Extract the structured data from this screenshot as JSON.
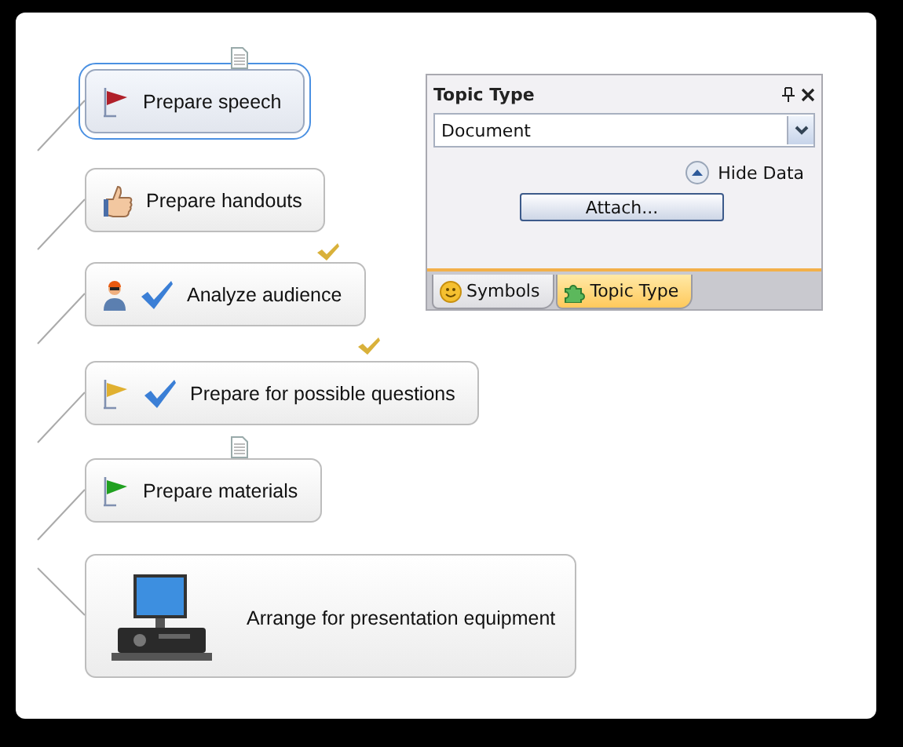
{
  "topics": [
    {
      "label": "Prepare speech",
      "selected": true,
      "note_attached": true,
      "completed": false,
      "symbols": [
        {
          "kind": "flag",
          "color": "#b0202a"
        }
      ]
    },
    {
      "label": "Prepare handouts",
      "selected": false,
      "note_attached": false,
      "completed": true,
      "symbols": [
        {
          "kind": "thumbs-up"
        }
      ]
    },
    {
      "label": "Analyze audience",
      "selected": false,
      "note_attached": false,
      "completed": true,
      "symbols": [
        {
          "kind": "person"
        },
        {
          "kind": "check"
        }
      ]
    },
    {
      "label": "Prepare for possible questions",
      "selected": false,
      "note_attached": false,
      "completed": false,
      "symbols": [
        {
          "kind": "flag",
          "color": "#e0b030"
        },
        {
          "kind": "check"
        }
      ]
    },
    {
      "label": "Prepare materials",
      "selected": false,
      "note_attached": true,
      "completed": false,
      "symbols": [
        {
          "kind": "flag",
          "color": "#20a020"
        }
      ]
    },
    {
      "label": "Arrange for presentation equipment",
      "selected": false,
      "note_attached": false,
      "completed": false,
      "symbols": [
        {
          "kind": "computer"
        }
      ]
    }
  ],
  "panel": {
    "title": "Topic Type",
    "dropdown": {
      "value": "Document"
    },
    "toggle": "Hide Data",
    "button": "Attach...",
    "tabs": [
      {
        "label": "Symbols",
        "selected": false,
        "kind": "smiley"
      },
      {
        "label": "Topic Type",
        "selected": true,
        "kind": "puzzle"
      }
    ]
  }
}
